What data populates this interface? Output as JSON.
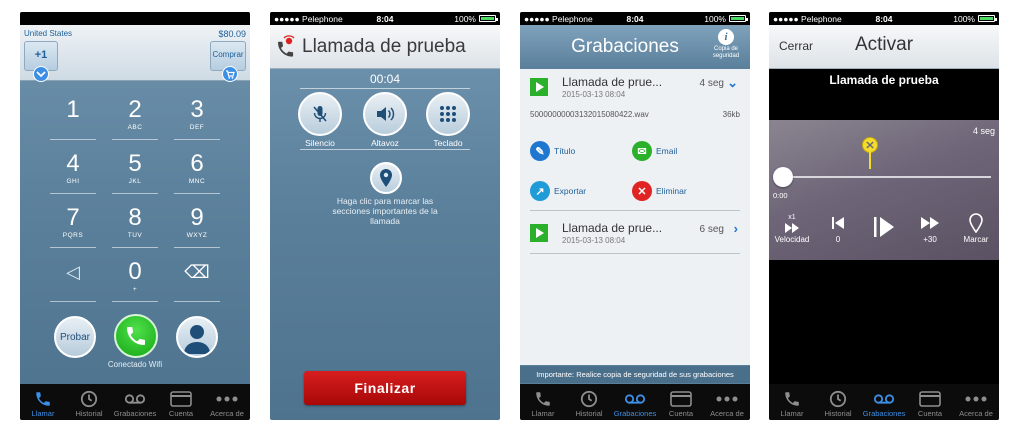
{
  "tabs": [
    {
      "label": "Llamar",
      "icon": "phone-icon"
    },
    {
      "label": "Historial",
      "icon": "clock-icon"
    },
    {
      "label": "Grabaciones",
      "icon": "voicemail-icon"
    },
    {
      "label": "Cuenta",
      "icon": "card-icon"
    },
    {
      "label": "Acerca de",
      "icon": "more-icon"
    }
  ],
  "dialer": {
    "country": "United States",
    "credit": "$80.09",
    "country_code": "+1",
    "buy_label": "Comprar",
    "keys": [
      {
        "digit": "1",
        "letters": ""
      },
      {
        "digit": "2",
        "letters": "ABC"
      },
      {
        "digit": "3",
        "letters": "DEF"
      },
      {
        "digit": "4",
        "letters": "GHI"
      },
      {
        "digit": "5",
        "letters": "JKL"
      },
      {
        "digit": "6",
        "letters": "MNC"
      },
      {
        "digit": "7",
        "letters": "PQRS"
      },
      {
        "digit": "8",
        "letters": "TUV"
      },
      {
        "digit": "9",
        "letters": "WXYZ"
      },
      {
        "digit": "◁",
        "letters": ""
      },
      {
        "digit": "0",
        "letters": "+"
      },
      {
        "digit": "⌫",
        "letters": ""
      }
    ],
    "test_label": "Probar",
    "wifi_status": "Conectado Wifi"
  },
  "call": {
    "status": {
      "carrier": "●●●●● Pelephone",
      "time": "8:04",
      "battery": "100%"
    },
    "title": "Llamada de prueba",
    "timer": "00:04",
    "controls": [
      {
        "label": "Silencio",
        "icon": "mic-off-icon"
      },
      {
        "label": "Altavoz",
        "icon": "speaker-icon"
      },
      {
        "label": "Teclado",
        "icon": "keypad-icon"
      }
    ],
    "hint": "Haga clic para marcar las secciones importantes de la llamada",
    "end_label": "Finalizar"
  },
  "recordings": {
    "status": {
      "carrier": "●●●●● Pelephone",
      "time": "8:04",
      "battery": "100%"
    },
    "title": "Grabaciones",
    "backup_label": "Copia de seguridad",
    "items": [
      {
        "name": "Llamada de prue...",
        "date": "2015-03-13 08:04",
        "duration": "4 seg"
      },
      {
        "name": "Llamada de prue...",
        "date": "2015-03-13 08:04",
        "duration": "6 seg"
      }
    ],
    "filename": "5000000000313201508042​2.wav",
    "filesize": "36kb",
    "actions": {
      "title": "Título",
      "email": "Email",
      "export": "Exportar",
      "delete": "Eliminar"
    },
    "footer": "Importante: Realice copia de seguridad de sus grabaciones"
  },
  "player": {
    "status": {
      "carrier": "●●●●● Pelephone",
      "time": "8:04",
      "battery": "100%"
    },
    "close_label": "Cerrar",
    "title": "Activar",
    "recording_name": "Llamada de prueba",
    "duration": "4 seg",
    "position": "0:00",
    "speed_value": "x1",
    "controls": {
      "speed": "Velocidad",
      "back": "0",
      "forward": "+30",
      "mark": "Marcar"
    }
  }
}
